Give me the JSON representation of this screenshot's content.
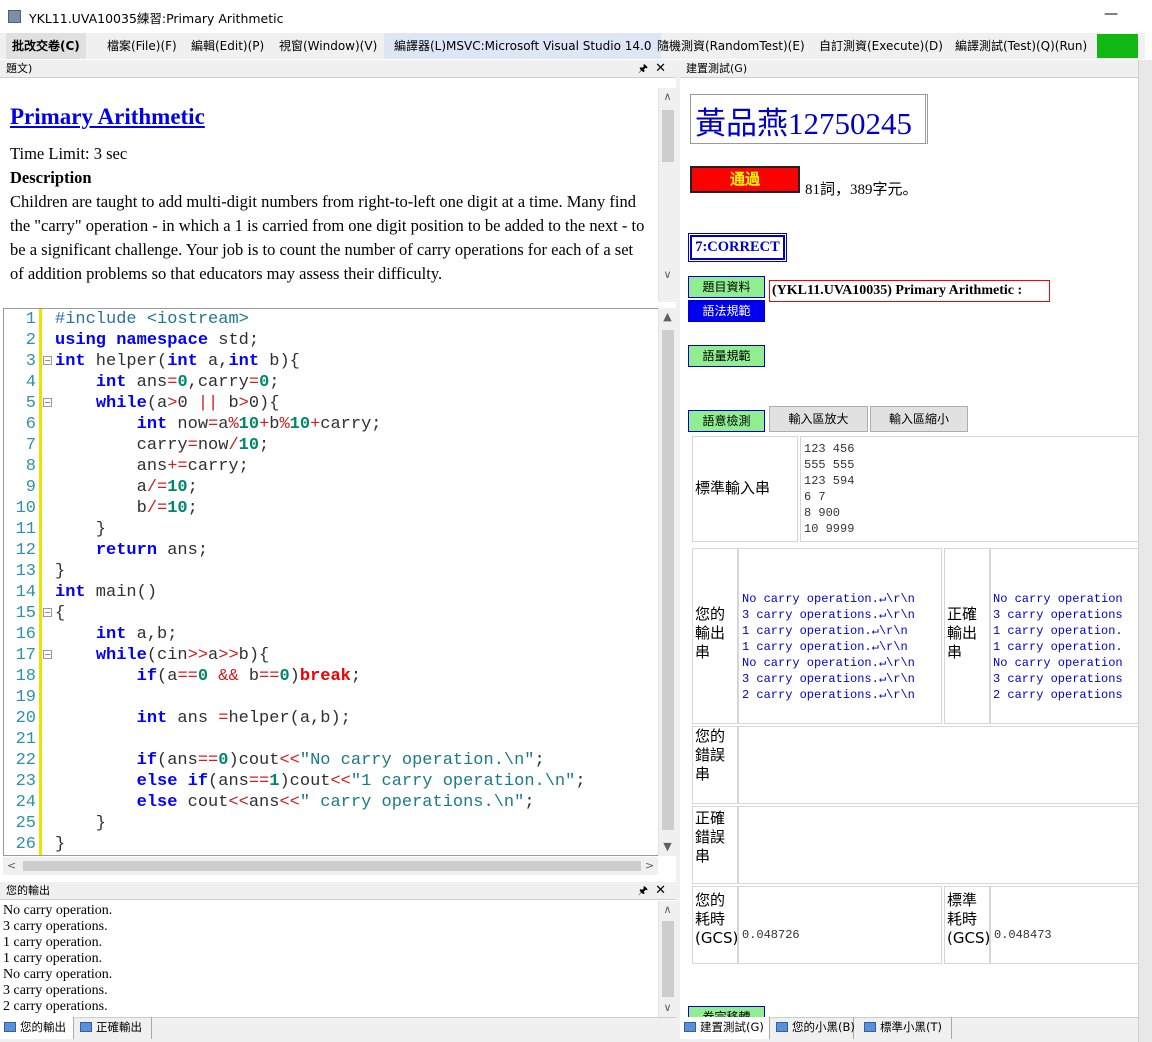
{
  "window": {
    "title": "YKL11.UVA10035練習:Primary Arithmetic",
    "minimize": "—"
  },
  "menu": {
    "items": [
      "批改交卷(C)",
      "檔案(File)(F)",
      "編輯(Edit)(P)",
      "視窗(Window)(V)",
      "編譯器(L)MSVC:Microsoft Visual Studio 14.0",
      "隨機測資(RandomTest)(E)",
      "自訂測資(Execute)(D)",
      "編譯測試(Test)(Q)(Run)"
    ]
  },
  "problem_pane": {
    "header": "題文)",
    "pin": "🖈",
    "close": "✕",
    "title": "Primary Arithmetic",
    "time_limit": "Time Limit: 3 sec",
    "description_heading": "Description",
    "description": "Children are taught to add multi-digit numbers from right-to-left one digit at a time. Many find the \"carry\" operation - in which a 1 is carried from one digit position to be added to the next - to be a significant challenge. Your job is to count the number of carry operations for each of a set of addition problems so that educators may assess their difficulty."
  },
  "code": {
    "line_numbers": [
      "1",
      "2",
      "3",
      "4",
      "5",
      "6",
      "7",
      "8",
      "9",
      "10",
      "11",
      "12",
      "13",
      "14",
      "15",
      "16",
      "17",
      "18",
      "19",
      "20",
      "21",
      "22",
      "23",
      "24",
      "25",
      "26"
    ]
  },
  "output_pane": {
    "header": "您的輸出",
    "lines": [
      "No carry operation.",
      "3 carry operations.",
      "1 carry operation.",
      "1 carry operation.",
      "No carry operation.",
      "3 carry operations.",
      "2 carry operations."
    ]
  },
  "bottom_tabs_left": [
    "您的輸出",
    "正確輸出"
  ],
  "bottom_tabs_right": [
    "建置測試(G)",
    "您的小黑(B)",
    "標準小黑(T)"
  ],
  "right_panel": {
    "header": "建置測試(G)",
    "student": "黃品燕12750245",
    "pass_label": "通過",
    "stats": "81詞，389字元。",
    "verdict": "7:CORRECT",
    "btn_problem_info": "題目資料",
    "btn_syntax_rules": "語法規範",
    "btn_volume_rules": "語量規範",
    "problem_tag": "(YKL11.UVA10035) Primary Arithmetic :",
    "btn_semantic_check": "語意檢測",
    "btn_input_enlarge": "輸入區放大",
    "btn_input_shrink": "輸入區縮小",
    "std_input_label": "標準輸入串",
    "std_input_lines": [
      "123 456",
      "555 555",
      "123 594",
      "6 7",
      "8 900",
      "10 9999"
    ],
    "your_output_label": "您的輸出串",
    "your_output_lines": [
      "No carry operation.↵\\r\\n",
      "3 carry operations.↵\\r\\n",
      "1 carry operation.↵\\r\\n",
      "1 carry operation.↵\\r\\n",
      "No carry operation.↵\\r\\n",
      "3 carry operations.↵\\r\\n",
      "2 carry operations.↵\\r\\n"
    ],
    "correct_output_label": "正確輸出串",
    "correct_output_lines": [
      "No carry operation",
      "3 carry operations",
      "1 carry operation.",
      "1 carry operation.",
      "No carry operation",
      "3 carry operations",
      "2 carry operations"
    ],
    "your_error_label": "您的錯誤串",
    "correct_error_label": "正確錯誤串",
    "your_time_label": "您的耗時(GCS)",
    "your_time": "0.048726",
    "std_time_label": "標準耗時(GCS)",
    "std_time": "0.048473",
    "bottom_btn": "卷宗移轉"
  },
  "colors": {
    "accent_green": "#90ee90",
    "pass_red": "#ff0000",
    "verdict_blue": "#0000cc"
  }
}
